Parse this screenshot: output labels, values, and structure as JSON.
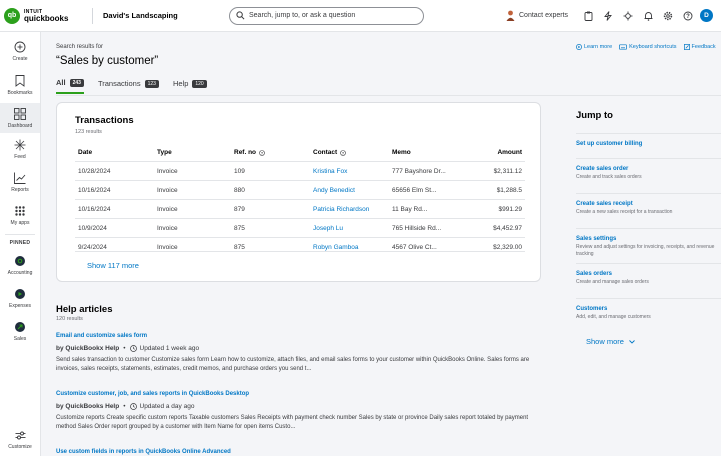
{
  "brand": {
    "line1": "INTUIT",
    "line2": "quickbooks",
    "mark": "qb"
  },
  "company": "David's Landscaping",
  "search": {
    "placeholder": "Search, jump to, or ask a question"
  },
  "contact_label": "Contact experts",
  "user_initial": "D",
  "colors": {
    "brand_green": "#2ca01c",
    "link_blue": "#0077c5",
    "text": "#393a3d"
  },
  "nav": [
    {
      "label": "Create",
      "icon": "plus-circle-icon"
    },
    {
      "label": "Bookmarks",
      "icon": "bookmark-icon"
    },
    {
      "label": "Dashboard",
      "icon": "dashboard-icon"
    },
    {
      "label": "Feed",
      "icon": "sparkle-icon"
    },
    {
      "label": "Reports",
      "icon": "chart-line-icon"
    },
    {
      "label": "My apps",
      "icon": "grid-icon"
    }
  ],
  "pinned_title": "PINNED",
  "pinned": [
    {
      "label": "Accounting"
    },
    {
      "label": "Expenses"
    },
    {
      "label": "Sales"
    }
  ],
  "customize_label": "Customize",
  "header": {
    "search_results_for": "Search results for",
    "query": "“Sales by customer”"
  },
  "toplinks": [
    "Learn more",
    "Keyboard shortcuts",
    "Feedback"
  ],
  "tabs": [
    {
      "label": "All",
      "count": "243"
    },
    {
      "label": "Transactions",
      "count": "123"
    },
    {
      "label": "Help",
      "count": "120"
    }
  ],
  "transactions": {
    "title": "Transactions",
    "count": "123 results",
    "columns": [
      "Date",
      "Type",
      "Ref. no",
      "Contact",
      "Memo",
      "Amount"
    ],
    "rows": [
      [
        "10/28/2024",
        "Invoice",
        "109",
        "Kristina Fox",
        "777 Bayshore Dr...",
        "$2,311.12"
      ],
      [
        "10/16/2024",
        "Invoice",
        "880",
        "Andy Benedict",
        "65656 Elm St...",
        "$1,288.5"
      ],
      [
        "10/16/2024",
        "Invoice",
        "879",
        "Patricia Richardson",
        "11 Bay Rd...",
        "$991.29"
      ],
      [
        "10/9/2024",
        "Invoice",
        "875",
        "Joseph Lu",
        "765 Hillside Rd...",
        "$4,452.97"
      ],
      [
        "9/24/2024",
        "Invoice",
        "875",
        "Robyn Gamboa",
        "4567 Olive Ct...",
        "$2,329.00"
      ]
    ],
    "show_more": "Show 117 more"
  },
  "help": {
    "title": "Help articles",
    "count": "120 results",
    "articles": [
      {
        "title": "Email and customize sales form",
        "by": "by QuickBookx Help",
        "updated": "Updated 1 week ago",
        "desc": "Send sales transaction to customer Customize sales form Learn how to customize, attach files, and email sales forms to your customer within QuickBooks Online. Sales forms are invoices, sales receipts, statements, estimates, credit memos, and purchase orders you send t..."
      },
      {
        "title": "Customize customer, job, and sales reports in QuickBooks Desktop",
        "by": "by QuickBooks Help",
        "updated": "Updated a day ago",
        "desc": "Customize reports Create specific custom reports Taxable customers Sales Receipts with payment check number Sales by state or province Daily sales report totaled by payment method Sales Order report grouped by a customer with Item Name for open items Custo..."
      },
      {
        "title": "Use custom fields in reports in QuickBooks Online Advanced"
      }
    ]
  },
  "jump": {
    "title": "Jump to",
    "items": [
      {
        "title": "Set up customer billing",
        "desc": ""
      },
      {
        "title": "Create sales order",
        "desc": "Create and track sales orders"
      },
      {
        "title": "Create sales receipt",
        "desc": "Create a new sales receipt for a transaction"
      },
      {
        "title": "Sales settings",
        "desc": "Review and adjust settings for invoicing, receipts, and revenue tracking"
      },
      {
        "title": "Sales orders",
        "desc": "Create and manage sales orders"
      },
      {
        "title": "Customers",
        "desc": "Add, edit, and manage customers"
      }
    ],
    "show_more": "Show more"
  }
}
